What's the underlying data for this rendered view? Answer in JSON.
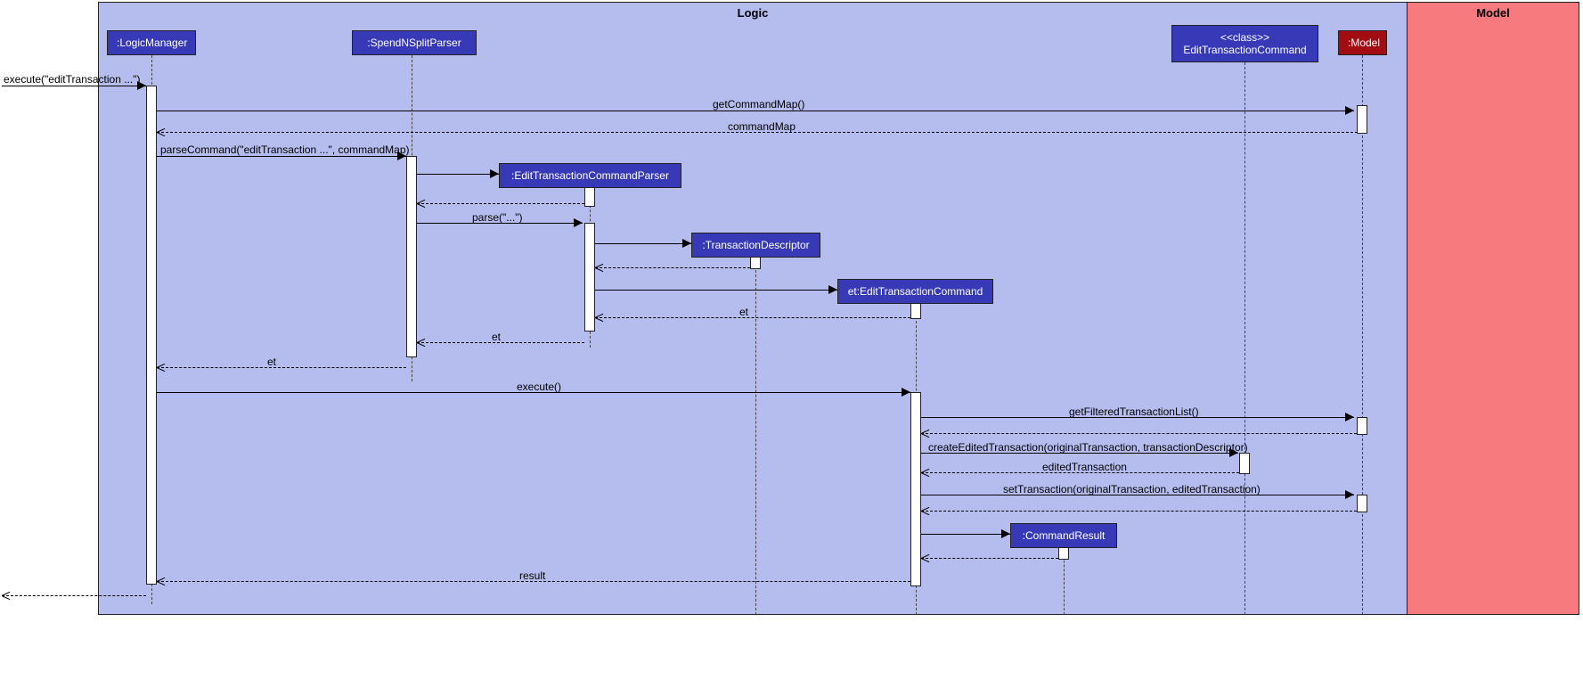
{
  "regions": {
    "logic": "Logic",
    "model": "Model"
  },
  "heads": {
    "logicManager": ":LogicManager",
    "spendNSplitParser": ":SpendNSplitParser",
    "editTxnCmdClass_line1": "<<class>>",
    "editTxnCmdClass_line2": "EditTransactionCommand",
    "model": ":Model",
    "editTxnCmdParser": ":EditTransactionCommandParser",
    "transactionDescriptor": ":TransactionDescriptor",
    "etEditTxnCmd": "et:EditTransactionCommand",
    "commandResult": ":CommandResult"
  },
  "messages": {
    "execute_entry": "execute(\"editTransaction ...\")",
    "getCommandMap": "getCommandMap()",
    "commandMap": "commandMap",
    "parseCommand": "parseCommand(\"editTransaction ...\", commandMap)",
    "parse": "parse(\"...\")",
    "et1": "et",
    "et2": "et",
    "et3": "et",
    "execute": "execute()",
    "getFilteredTxnList": "getFilteredTransactionList()",
    "createEditedTxn": "createEditedTransaction(originalTransaction, transactionDescriptor)",
    "editedTransaction": "editedTransaction",
    "setTransaction": "setTransaction(originalTransaction, editedTransaction)",
    "result": "result"
  }
}
